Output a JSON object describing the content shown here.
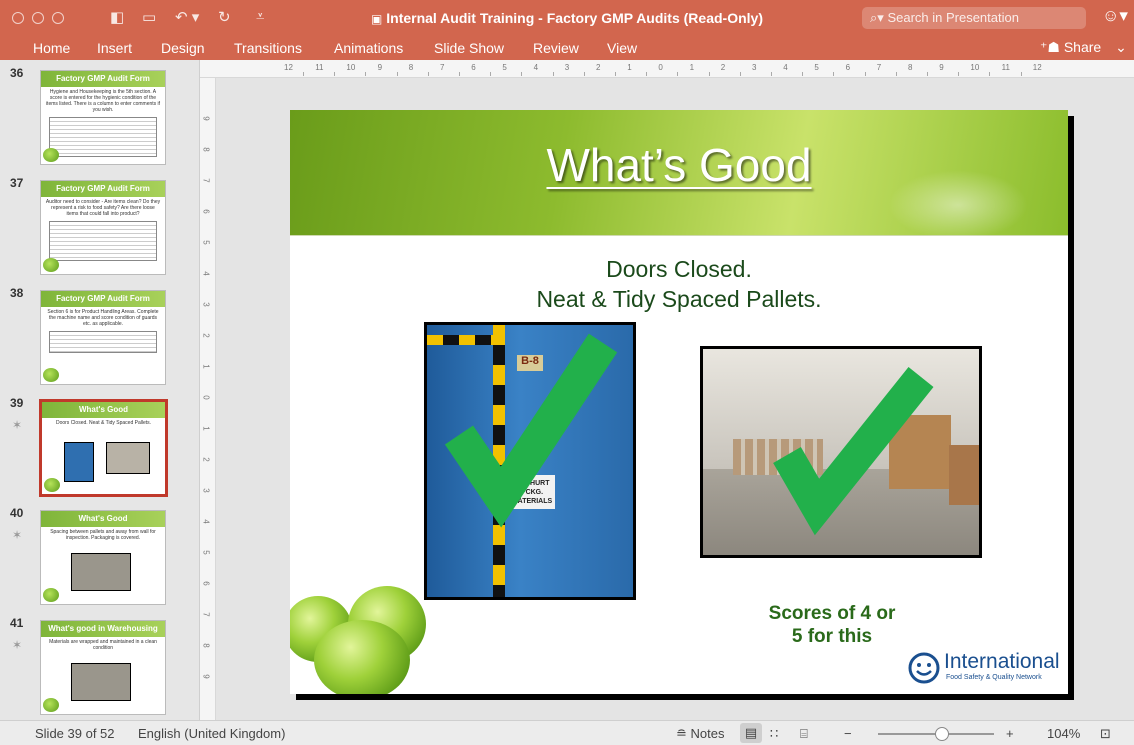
{
  "window": {
    "title": "Internal Audit Training - Factory GMP Audits (Read-Only)",
    "search_placeholder": "Search in Presentation"
  },
  "ribbon": {
    "tabs": [
      "Home",
      "Insert",
      "Design",
      "Transitions",
      "Animations",
      "Slide Show",
      "Review",
      "View"
    ],
    "share_label": "Share"
  },
  "ruler": {
    "top_ticks": [
      "12",
      "11",
      "10",
      "9",
      "8",
      "7",
      "6",
      "5",
      "4",
      "3",
      "2",
      "1",
      "0",
      "1",
      "2",
      "3",
      "4",
      "5",
      "6",
      "7",
      "8",
      "9",
      "10",
      "11",
      "12"
    ],
    "left_ticks": [
      "9",
      "8",
      "7",
      "6",
      "5",
      "4",
      "3",
      "2",
      "1",
      "0",
      "1",
      "2",
      "3",
      "4",
      "5",
      "6",
      "7",
      "8",
      "9"
    ]
  },
  "thumbnails": [
    {
      "number": "36",
      "title": "Factory GMP Audit Form",
      "text": "Hygiene and Housekeeping is the 5th section. A score is entered for the hygienic condition of the items listed. There is a column to enter comments if you wish.",
      "kind": "form",
      "starred": false
    },
    {
      "number": "37",
      "title": "Factory GMP Audit Form",
      "text": "Auditor need to consider - Are items clean? Do they represent a risk to food safety? Are there loose items that could fall into product?",
      "kind": "form",
      "starred": false
    },
    {
      "number": "38",
      "title": "Factory GMP Audit Form",
      "text": "Section 6 is for Product Handling Areas. Complete the machine name and score condition of guards etc. as applicable.",
      "kind": "form-short",
      "starred": false
    },
    {
      "number": "39",
      "title": "What's Good",
      "text": "Doors Closed. Neat & Tidy Spaced Pallets.",
      "kind": "photos",
      "starred": true,
      "selected": true
    },
    {
      "number": "40",
      "title": "What's Good",
      "text": "Spacing between pallets and away from wall for inspection. Packaging is covered.",
      "kind": "photo-one",
      "starred": true
    },
    {
      "number": "41",
      "title": "What's good in Warehousing",
      "text": "Materials are wrapped and maintained in a clean condition",
      "kind": "photo-one",
      "starred": true
    }
  ],
  "slide": {
    "title": "What’s Good",
    "line1": "Doors Closed.",
    "line2": "Neat & Tidy Spaced Pallets.",
    "door_label": "B-8",
    "sign_text": "YOGHURT PCKG. MATERIALS",
    "scores_line1": "Scores of 4 or",
    "scores_line2": "5 for this",
    "logo_main": "International",
    "logo_sub": "Food Safety & Quality Network"
  },
  "statusbar": {
    "slide_counter": "Slide 39 of 52",
    "language": "English (United Kingdom)",
    "notes_label": "Notes",
    "zoom": "104%",
    "zoom_level": 0.55
  },
  "colors": {
    "titlebar": "#d2664e",
    "selection": "#c0392b",
    "slide_green": "#8dbb2e",
    "check_green": "#22b04b"
  }
}
